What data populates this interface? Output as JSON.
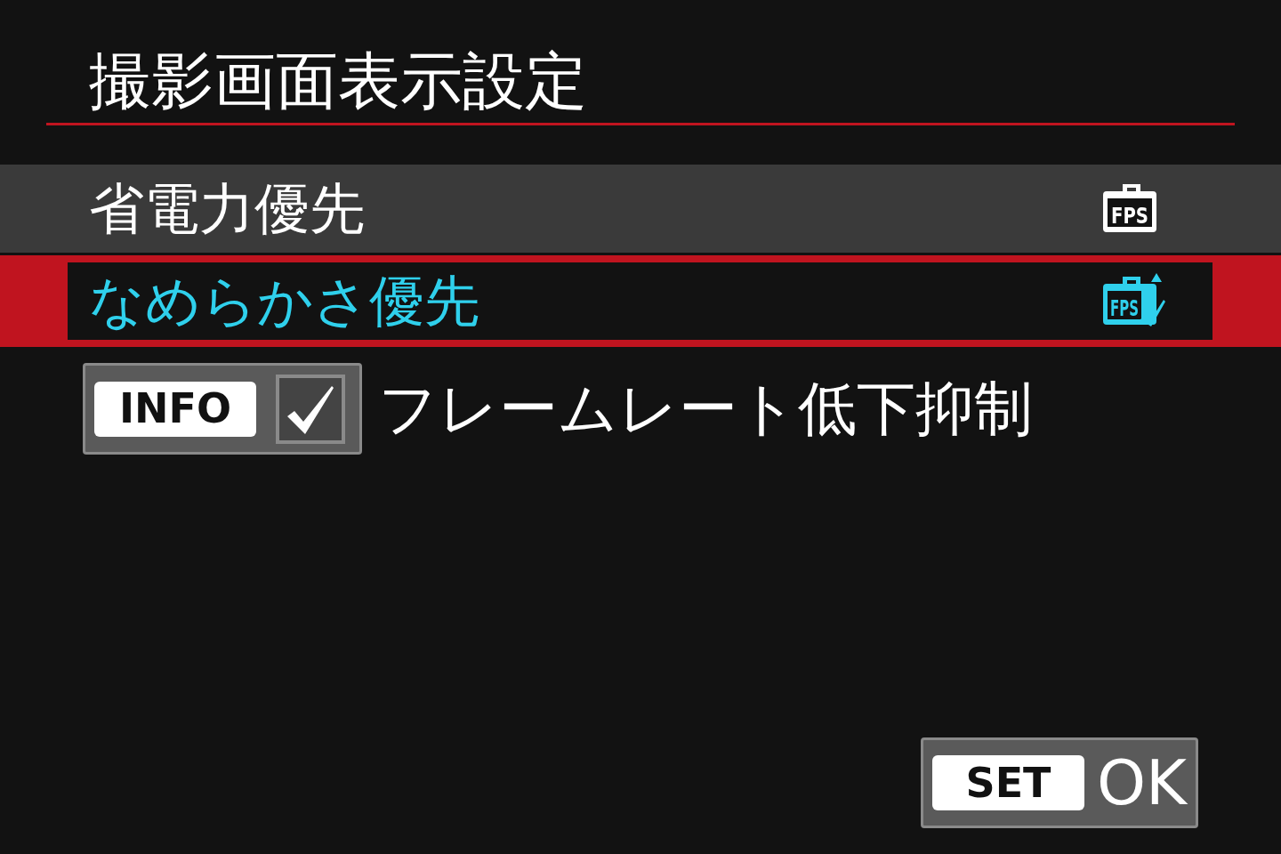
{
  "title": "撮影画面表示設定",
  "options": [
    {
      "label": "省電力優先",
      "icon_label": "FPS",
      "kind": "standard",
      "selected": false
    },
    {
      "label": "なめらかさ優先",
      "icon_label": "FPS",
      "kind": "smooth",
      "selected": true
    }
  ],
  "info_toggle": {
    "key": "INFO",
    "checked": true,
    "label": "フレームレート低下抑制"
  },
  "confirm": {
    "key": "SET",
    "label": "OK"
  }
}
